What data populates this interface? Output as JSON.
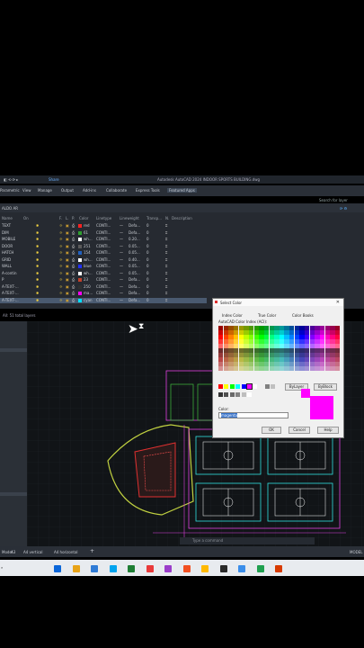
{
  "window": {
    "title": "Autodesk AutoCAD 2024  INDOOR SPORTS BUILDING.dwg",
    "share": "Share"
  },
  "ribbon": {
    "tabs": [
      "Parametric",
      "View",
      "Manage",
      "Output",
      "Add-ins",
      "Collaborate",
      "Express Tools",
      "Featured Apps"
    ]
  },
  "layer_panel": {
    "search": "Search for layer",
    "current": "ALDO AR",
    "headers": {
      "status": "S",
      "name": "Name",
      "on": "On",
      "freeze": "F.",
      "lock": "L.",
      "plot": "P.",
      "color": "Color",
      "linetype": "Linetype",
      "lineweight": "Lineweight",
      "transparency": "Transp...",
      "newvp": "N.",
      "description": "Description"
    },
    "rows": [
      {
        "name": "TEXT",
        "color": "red",
        "sw": "#ff2020",
        "lt": "CONTI...",
        "lw": "Defa...",
        "tr": "0"
      },
      {
        "name": "DIM",
        "color": "61",
        "sw": "#2ea02e",
        "lt": "CONTI...",
        "lw": "Defa...",
        "tr": "0"
      },
      {
        "name": "MOBILE",
        "color": "wh...",
        "sw": "#ffffff",
        "lt": "CONTI...",
        "lw": "0.20...",
        "tr": "0"
      },
      {
        "name": "DOOR",
        "color": "251",
        "sw": "#5a5a5a",
        "lt": "CONTI...",
        "lw": "0.05...",
        "tr": "0"
      },
      {
        "name": "HATCH",
        "color": "154",
        "sw": "#2060c0",
        "lt": "CONTI...",
        "lw": "0.05...",
        "tr": "0"
      },
      {
        "name": "GRID",
        "color": "wh...",
        "sw": "#ffffff",
        "lt": "CONTI...",
        "lw": "0.40...",
        "tr": "0"
      },
      {
        "name": "WALL",
        "color": "blue",
        "sw": "#2030ff",
        "lt": "CONTI...",
        "lw": "0.05...",
        "tr": "0"
      },
      {
        "name": "A-contin",
        "color": "wh...",
        "sw": "#ffffff",
        "lt": "CONTI...",
        "lw": "0.05...",
        "tr": "0"
      },
      {
        "name": "P",
        "color": "23",
        "sw": "#c0402a",
        "lt": "CONTI...",
        "lw": "Defa...",
        "tr": "0"
      },
      {
        "name": "A-TEXT-...",
        "color": "250",
        "sw": "#303030",
        "lt": "CONTI...",
        "lw": "Defa...",
        "tr": "0"
      },
      {
        "name": "A-TEXT-...",
        "color": "ma...",
        "sw": "#ff00ff",
        "lt": "CONTI...",
        "lw": "Defa...",
        "tr": "0"
      },
      {
        "name": "A-TEXT-...",
        "color": "cyan",
        "sw": "#00e0ff",
        "lt": "CONTI...",
        "lw": "Defa...",
        "tr": "0"
      }
    ],
    "total": "All: 51 total layers"
  },
  "dialog": {
    "title": "Select Color",
    "tabs": [
      "Index Color",
      "True Color",
      "Color Books"
    ],
    "aci_label": "AutoCAD Color Index (ACI):",
    "bylayer": "ByLayer",
    "byblock": "ByBlock",
    "color_label": "Color:",
    "color_value": "magenta",
    "ok": "OK",
    "cancel": "Cancel",
    "help": "Help"
  },
  "bottom_tabs": [
    "Model",
    "A3",
    "A4 vertical",
    "A4 horizontal",
    "+"
  ],
  "command_placeholder": "Type a command",
  "model_label": "MODEL",
  "taskbar_colors": [
    "#0a66d9",
    "#e8a317",
    "#2f7bd6",
    "#00a4ef",
    "#1e7e34",
    "#e93a3a",
    "#9b3dca",
    "#f25022",
    "#ffb900",
    "#2a2a2a",
    "#3b8eea",
    "#20a050",
    "#d83b01"
  ]
}
